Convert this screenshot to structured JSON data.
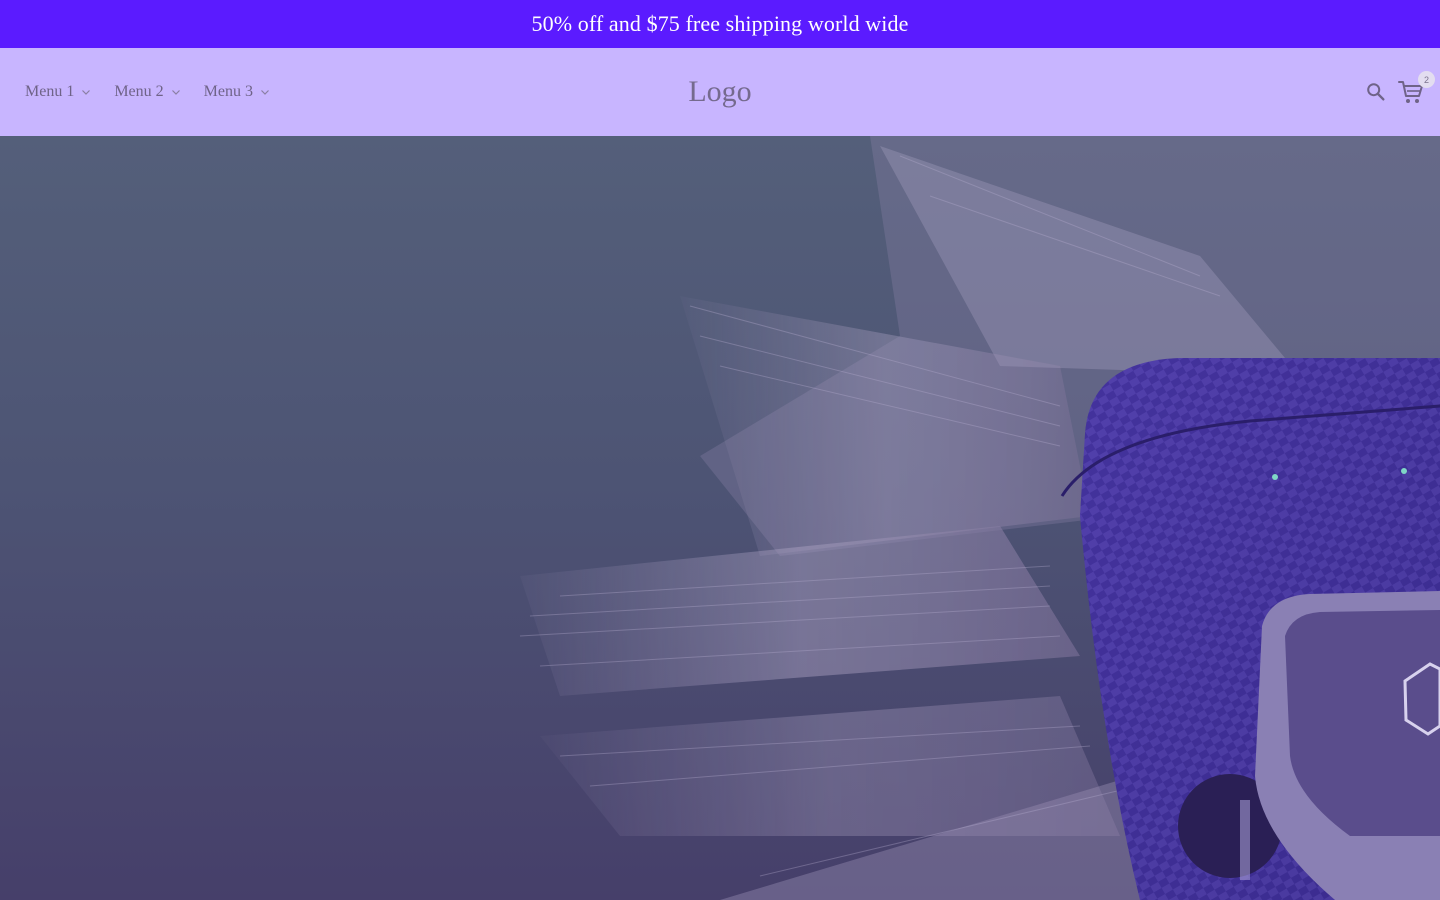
{
  "announcement": {
    "text": "50% off and $75 free shipping world wide"
  },
  "header": {
    "menu": [
      {
        "label": "Menu 1"
      },
      {
        "label": "Menu 2"
      },
      {
        "label": "Menu 3"
      }
    ],
    "logo": "Logo",
    "search_icon": "search-icon",
    "cart_icon": "cart-icon",
    "cart_count": "2"
  },
  "hero": {
    "image": "wireless-earbuds-case-with-fiber-burst"
  },
  "colors": {
    "announcement_bg": "#5b1bff",
    "header_bg": "#c8b5ff",
    "hero_bg": "#4d5474",
    "case_purple": "#433094"
  }
}
